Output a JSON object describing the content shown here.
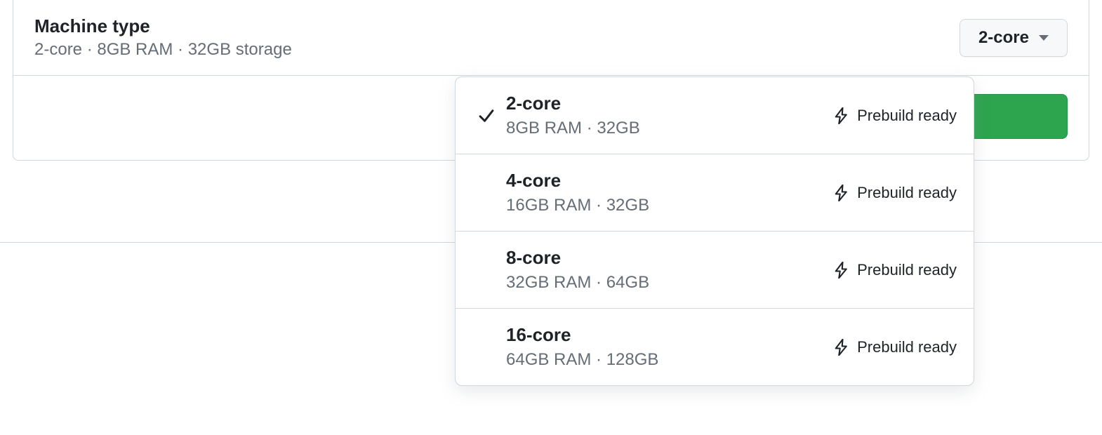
{
  "header": {
    "title": "Machine type",
    "subtitle": "2-core · 8GB RAM · 32GB storage"
  },
  "selector": {
    "current": "2-core"
  },
  "prebuild_label": "Prebuild ready",
  "options": [
    {
      "title": "2-core",
      "sub": "8GB RAM · 32GB",
      "selected": true,
      "prebuild": true
    },
    {
      "title": "4-core",
      "sub": "16GB RAM · 32GB",
      "selected": false,
      "prebuild": true
    },
    {
      "title": "8-core",
      "sub": "32GB RAM · 64GB",
      "selected": false,
      "prebuild": true
    },
    {
      "title": "16-core",
      "sub": "64GB RAM · 128GB",
      "selected": false,
      "prebuild": true
    }
  ]
}
